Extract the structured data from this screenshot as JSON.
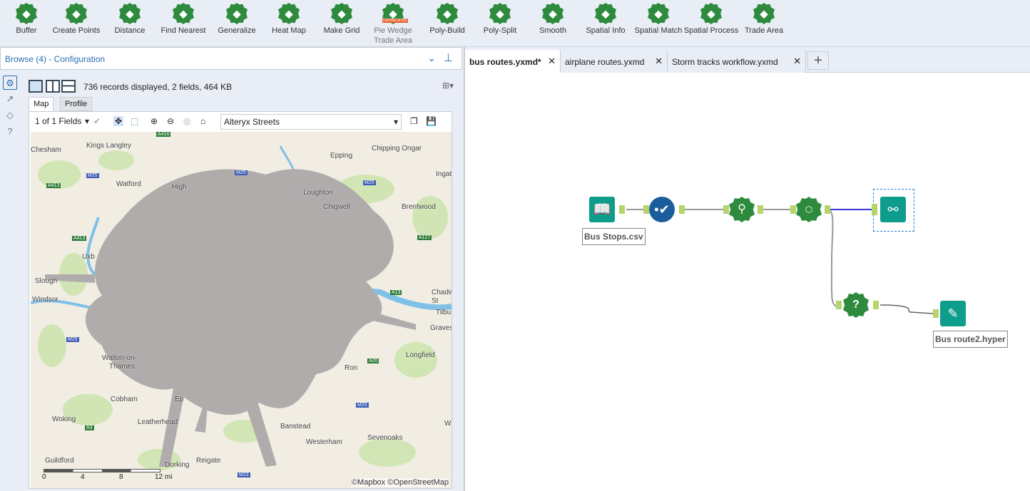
{
  "ribbon": {
    "tools": [
      {
        "label": "Buffer",
        "icon": "buffer-icon"
      },
      {
        "label": "Create Points",
        "icon": "create-points-icon"
      },
      {
        "label": "Distance",
        "icon": "distance-icon"
      },
      {
        "label": "Find Nearest",
        "icon": "find-nearest-icon"
      },
      {
        "label": "Generalize",
        "icon": "generalize-icon"
      },
      {
        "label": "Heat Map",
        "icon": "heat-map-icon"
      },
      {
        "label": "Make Grid",
        "icon": "make-grid-icon"
      },
      {
        "label": "Pie Wedge Trade Area",
        "icon": "pie-wedge-icon",
        "badge": "DEPRECATED"
      },
      {
        "label": "Poly-Build",
        "icon": "poly-build-icon"
      },
      {
        "label": "Poly-Split",
        "icon": "poly-split-icon"
      },
      {
        "label": "Smooth",
        "icon": "smooth-icon"
      },
      {
        "label": "Spatial Info",
        "icon": "spatial-info-icon"
      },
      {
        "label": "Spatial Match",
        "icon": "spatial-match-icon"
      },
      {
        "label": "Spatial Process",
        "icon": "spatial-process-icon"
      },
      {
        "label": "Trade Area",
        "icon": "trade-area-icon"
      }
    ]
  },
  "config": {
    "title": "Browse (4) - Configuration",
    "records": "736 records displayed, 2 fields, 464 KB",
    "tabs": [
      "Map",
      "Profile"
    ],
    "fields": "1 of 1 Fields",
    "basemap": "Alteryx Streets"
  },
  "map": {
    "places": [
      "Chesham",
      "Kings Langley",
      "Epping",
      "Chipping Ongar",
      "Ingat",
      "Watford",
      "High",
      "Loughton",
      "Chigwell",
      "Brentwood",
      "Uxb",
      "Slough",
      "Windsor",
      "Chadw",
      "St",
      "Tilbu",
      "Graves",
      "Walton-on-",
      "Thames",
      "Longfield",
      "Cobham",
      "Ep",
      "Woking",
      "Leatherhead",
      "Banstead",
      "Westerham",
      "Sevenoaks",
      "Guildford",
      "Reigate",
      "Dorking",
      "Ron",
      "W"
    ],
    "roads": [
      "A416",
      "M25",
      "A413",
      "M25",
      "A413",
      "A127",
      "A13",
      "M25",
      "M25",
      "A3",
      "M23",
      "A20",
      "M25"
    ],
    "scale": [
      "0",
      "4",
      "8",
      "12 mi"
    ],
    "attribution": "©Mapbox ©OpenStreetMap"
  },
  "canvas": {
    "tabs": [
      {
        "label": "bus routes.yxmd*"
      },
      {
        "label": "airplane routes.yxmd"
      },
      {
        "label": "Storm tracks workflow.yxmd"
      }
    ],
    "add_tab": "+",
    "labels": {
      "input": "Bus Stops.csv",
      "output": "Bus route2.hyper"
    }
  },
  "colors": {
    "tool_green": "#2e8b3e",
    "io_teal": "#0e9c8c",
    "select_blue": "#1b5d9c",
    "anchor": "#b5d46a"
  }
}
